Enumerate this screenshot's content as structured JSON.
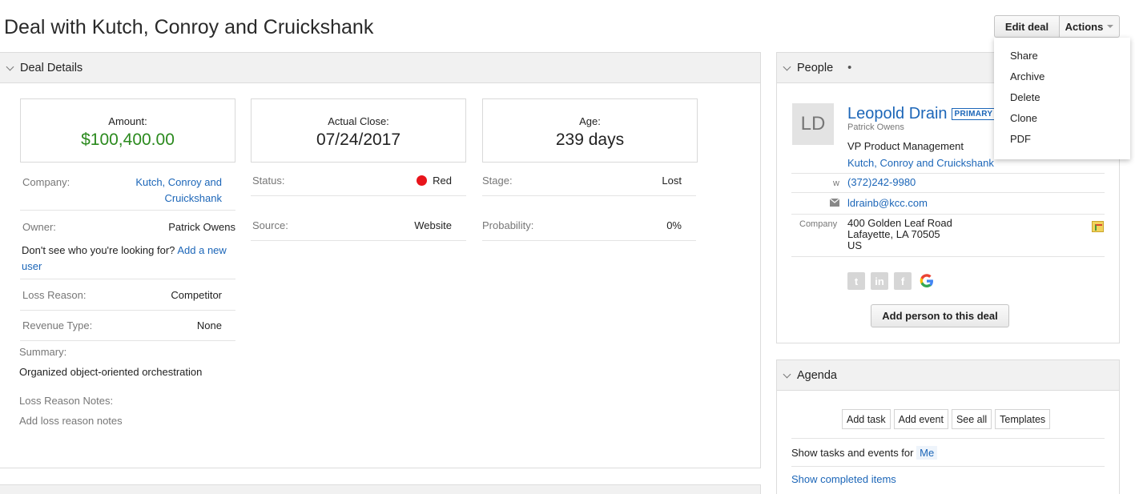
{
  "page": {
    "title": "Deal with Kutch, Conroy and Cruickshank"
  },
  "toolbar": {
    "edit_label": "Edit deal",
    "actions_label": "Actions"
  },
  "actions_menu": [
    "Share",
    "Archive",
    "Delete",
    "Clone",
    "PDF"
  ],
  "deal_details": {
    "header": "Deal Details",
    "amount_label": "Amount:",
    "amount_value": "$100,400.00",
    "close_label": "Actual Close:",
    "close_value": "07/24/2017",
    "age_label": "Age:",
    "age_value": "239 days",
    "company_label": "Company:",
    "company_line1": "Kutch, Conroy and",
    "company_line2": "Cruickshank",
    "owner_label": "Owner:",
    "owner_value": "Patrick Owens",
    "missing_user_text": "Don't see who you're looking for?",
    "add_user_link1": "Add a",
    "add_user_link2": "new user",
    "loss_reason_label": "Loss Reason:",
    "loss_reason_value": "Competitor",
    "revenue_type_label": "Revenue Type:",
    "revenue_type_value": "None",
    "status_label": "Status:",
    "status_value": "Red",
    "source_label": "Source:",
    "source_value": "Website",
    "stage_label": "Stage:",
    "stage_value": "Lost",
    "probability_label": "Probability:",
    "probability_value": "0%",
    "summary_label": "Summary:",
    "summary_value": "Organized object-oriented orchestration",
    "loss_notes_label": "Loss Reason Notes:",
    "loss_notes_placeholder": "Add loss reason notes",
    "status_color": "#e8141b",
    "amount_color": "#2b8a1e"
  },
  "people": {
    "header": "People",
    "header_dot": "•",
    "avatar_initials": "LD",
    "name": "Leopold Drain",
    "badge": "PRIMARY",
    "owner": "Patrick Owens",
    "title": "VP Product Management",
    "company": "Kutch, Conroy and Cruickshank",
    "phone_type": "w",
    "phone": "(372)242-9980",
    "email": "ldrainb@kcc.com",
    "address_label": "Company",
    "address_line1": "400 Golden Leaf Road",
    "address_line2": "Lafayette, LA 70505",
    "address_line3": "US",
    "add_person_label": "Add person to this deal"
  },
  "agenda": {
    "header": "Agenda",
    "buttons": [
      "Add task",
      "Add event",
      "See all",
      "Templates"
    ],
    "show_for_label": "Show tasks and events for",
    "show_for_value": "Me",
    "show_completed": "Show completed items"
  }
}
